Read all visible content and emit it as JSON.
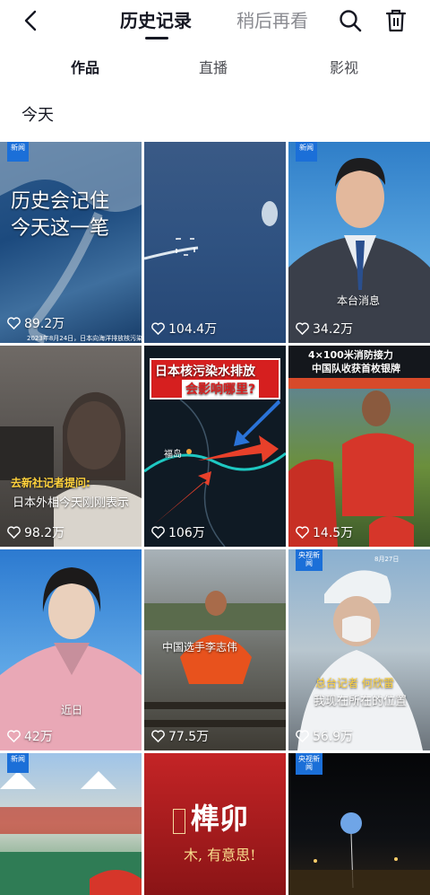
{
  "header": {
    "tab_history": "历史记录",
    "tab_later": "稍后再看"
  },
  "subtabs": [
    "作品",
    "直播",
    "影视"
  ],
  "section_title": "今天",
  "tiles": [
    {
      "likes": "89.2万",
      "caption": "历史会记住",
      "caption2": "今天这一笔",
      "note": "2023年8月24日，日本向海洋排放核污染水",
      "badge": "新闻"
    },
    {
      "likes": "104.4万"
    },
    {
      "likes": "34.2万",
      "caption": "本台消息",
      "badge": "新闻"
    },
    {
      "likes": "98.2万",
      "caption": "去新社记者提问:",
      "caption2": "日本外相今天刚刚表示"
    },
    {
      "likes": "106万",
      "caption": "日本核污染水排放",
      "caption2": "会影响哪里?",
      "label": "福岛"
    },
    {
      "likes": "14.5万",
      "caption": "4×100米消防接力",
      "caption2": "中国队收获首枚银牌"
    },
    {
      "likes": "42万",
      "caption": "近日"
    },
    {
      "likes": "77.5万",
      "caption": "中国选手李志伟"
    },
    {
      "likes": "56.9万",
      "caption": "总台记者 何欣雷",
      "caption2": "我现在所在的位置",
      "badge": "央视新闻",
      "note": "8月27日"
    },
    {
      "badge": "新闻"
    },
    {
      "caption": "榫卯",
      "caption2": "木, 有意思!"
    },
    {
      "badge": "央视新闻"
    }
  ]
}
